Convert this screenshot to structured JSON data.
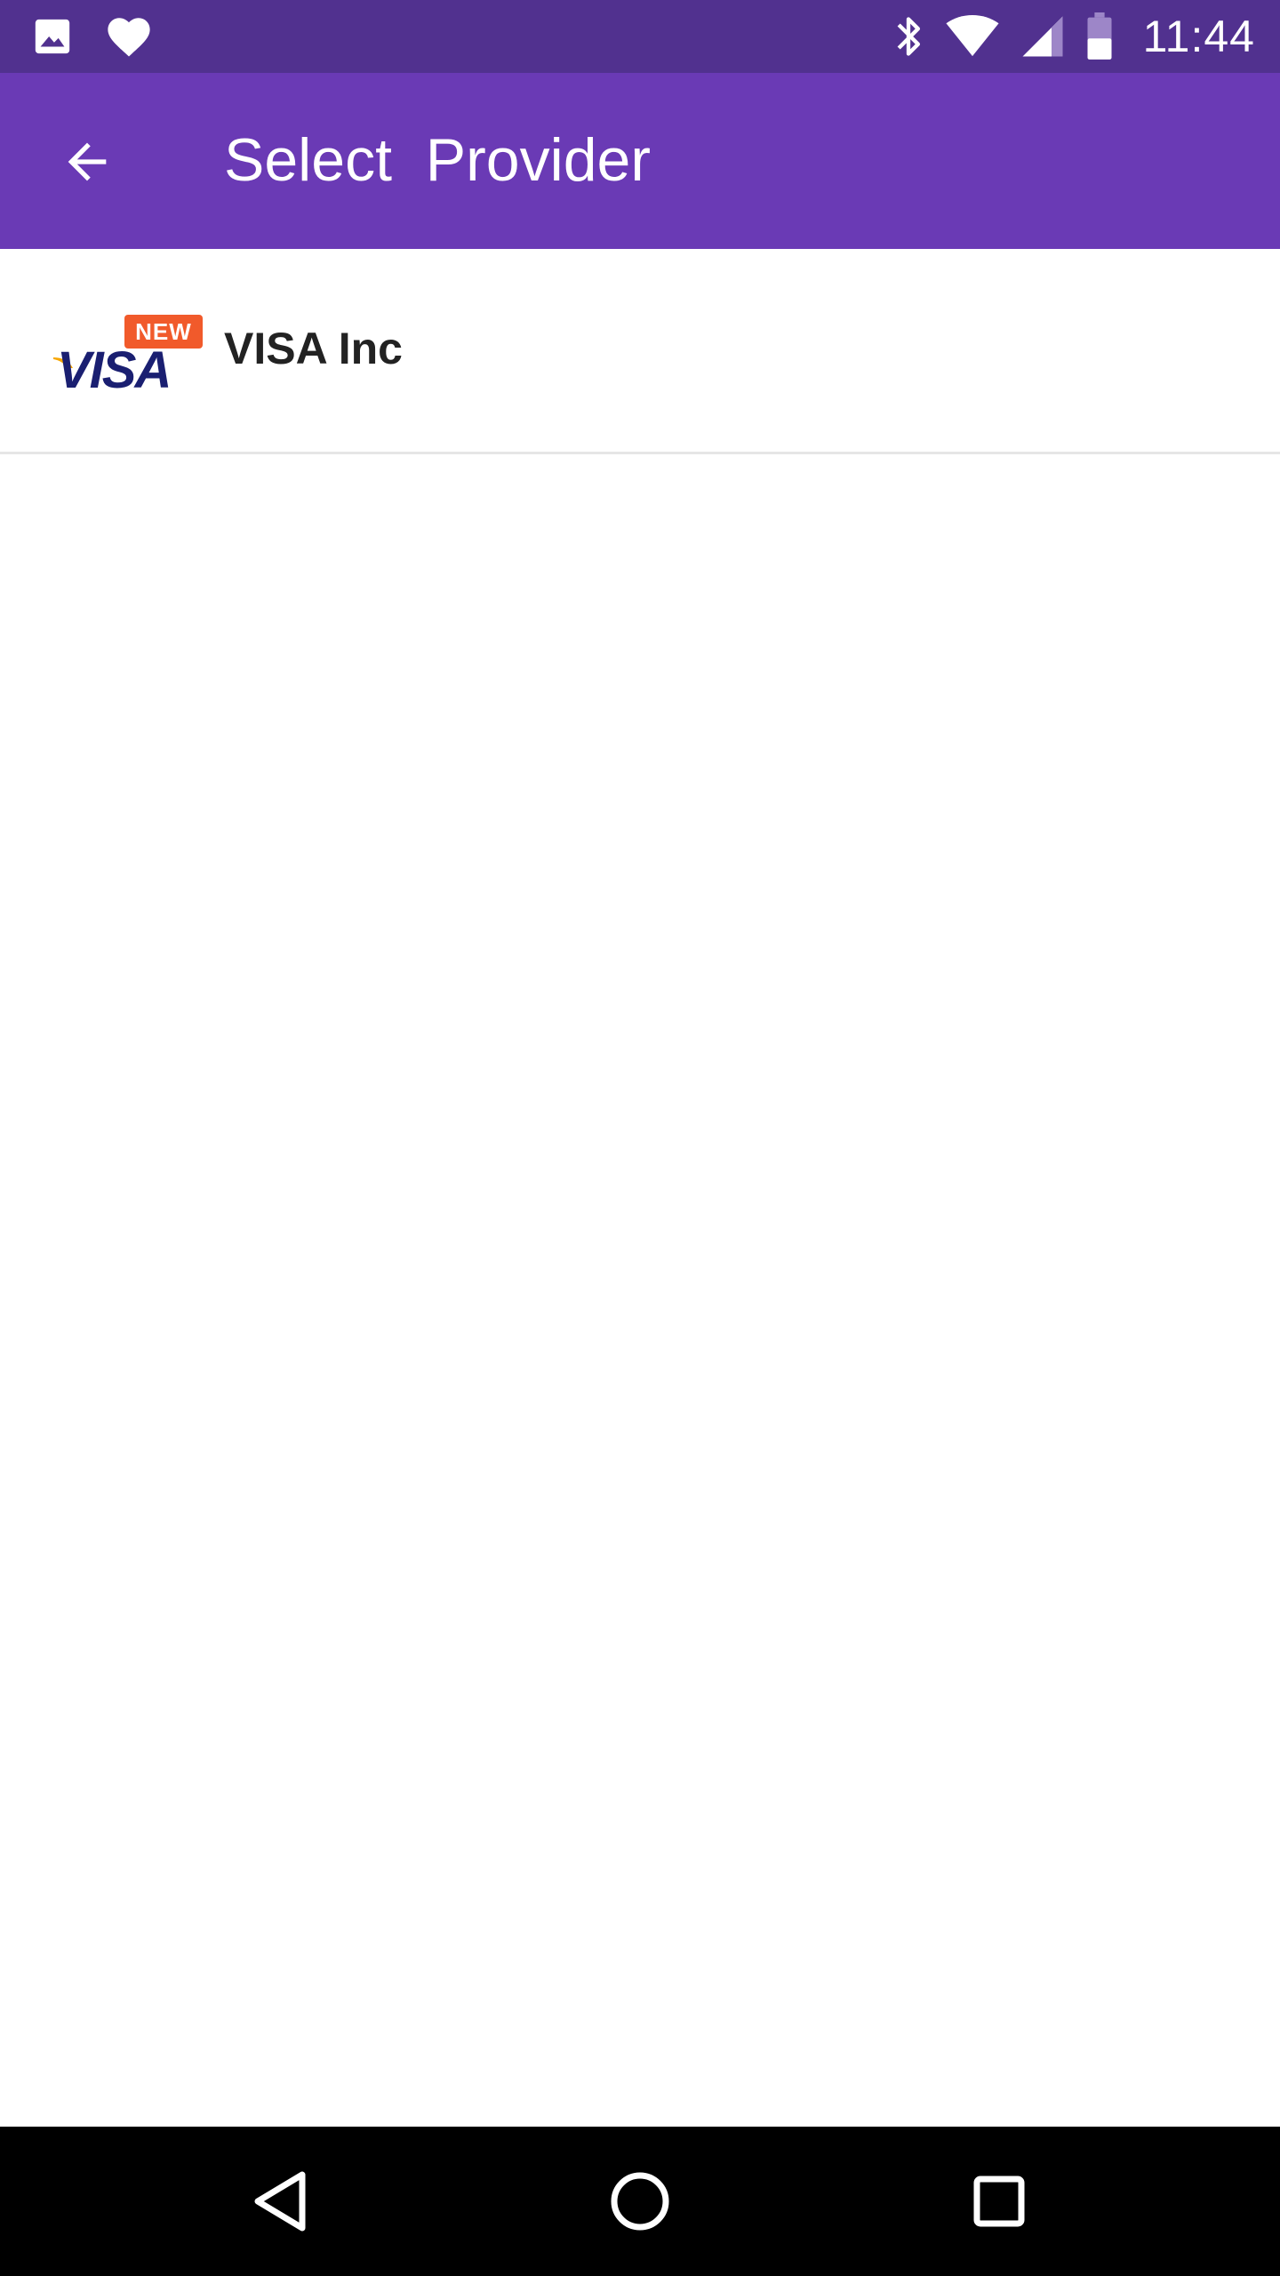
{
  "status_bar": {
    "time": "11:44",
    "left_icons": [
      "image-icon",
      "heart-icon"
    ],
    "right_icons": [
      "bluetooth-icon",
      "wifi-icon",
      "signal-icon",
      "battery-icon"
    ]
  },
  "app_bar": {
    "title": "Select  Provider",
    "back_icon": "arrow-back-icon"
  },
  "providers": [
    {
      "name": "VISA Inc",
      "logo_text": "VISA",
      "badge": "NEW"
    }
  ],
  "nav_bar": {
    "buttons": [
      "back-triangle-icon",
      "home-circle-icon",
      "recents-square-icon"
    ]
  },
  "colors": {
    "status_bar": "#51318f",
    "app_bar": "#6a3ab5",
    "badge": "#f15a2b",
    "visa_blue": "#1a1f71",
    "visa_gold": "#f7a600"
  }
}
